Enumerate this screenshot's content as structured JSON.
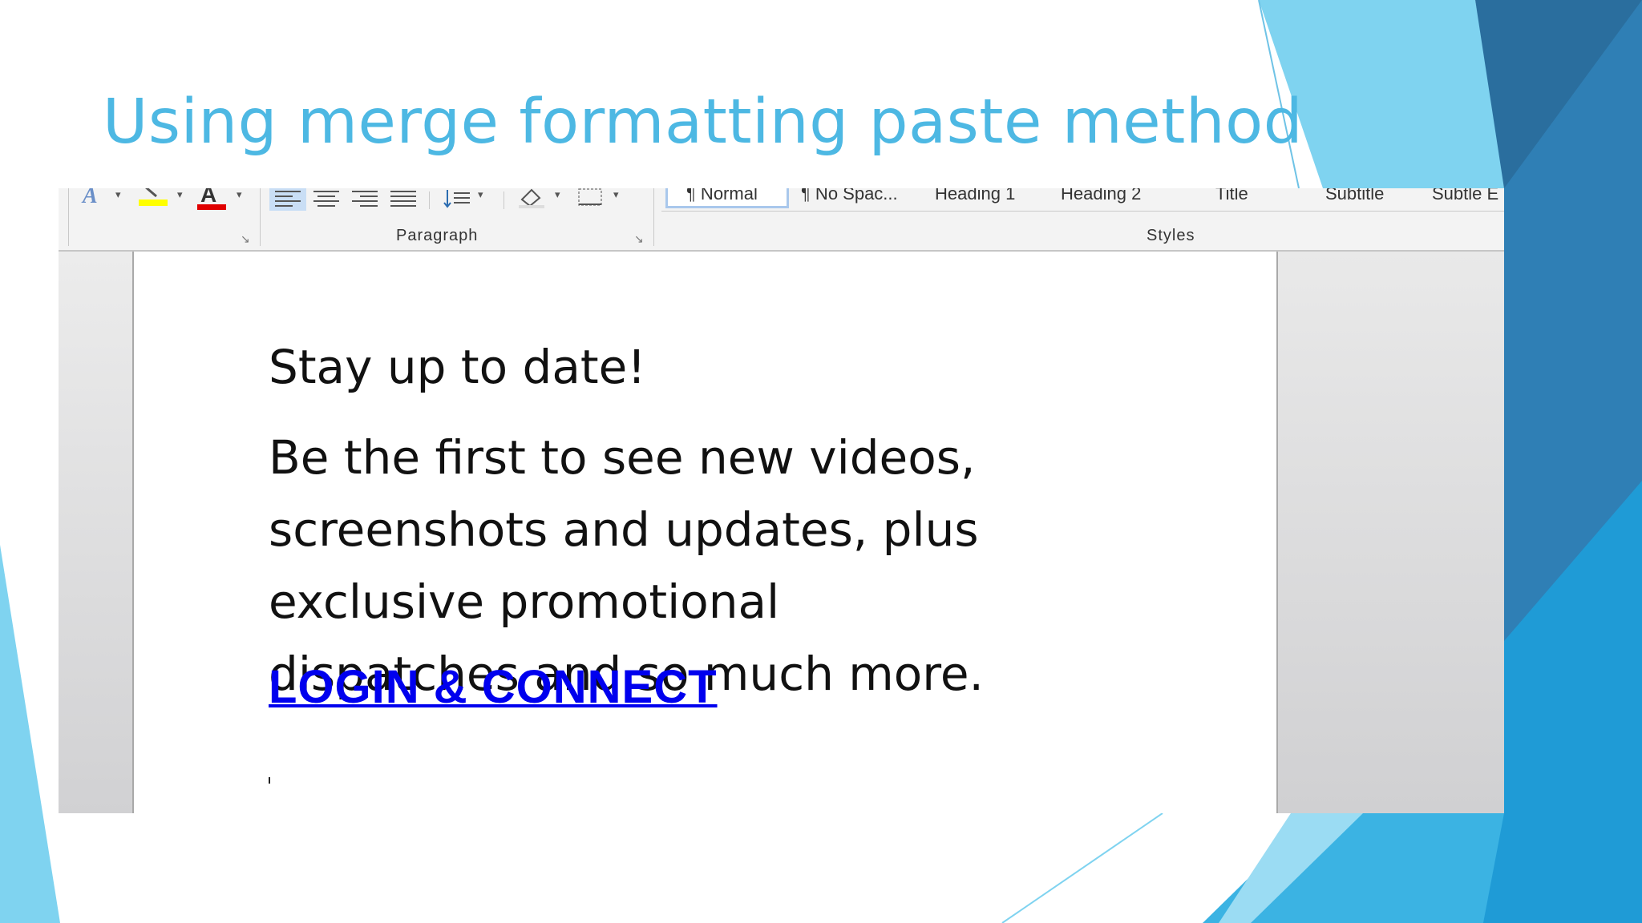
{
  "slide": {
    "title": "Using merge formatting paste method"
  },
  "ribbon": {
    "paragraph_label": "Paragraph",
    "styles_label": "Styles",
    "styles": [
      "¶ Normal",
      "¶ No Spac...",
      "Heading 1",
      "Heading 2",
      "Title",
      "Subtitle",
      "Subtle E"
    ],
    "font_color_glyph": "A",
    "text_effects_glyph": "A",
    "launcher_glyph": "↘",
    "caret_glyph": "▾"
  },
  "document": {
    "heading": "Stay up to date!",
    "body_lines": [
      "Be the first to see new videos,",
      "screenshots and updates, plus",
      "exclusive promotional",
      "dispatches and so much more."
    ],
    "link": "LOGIN & CONNECT"
  },
  "colors": {
    "title": "#4db8e3",
    "link": "#0000ee",
    "highlight": "#ffff00",
    "font_color": "#e00000",
    "accent_light": "#7fd3f0",
    "accent_dark": "#2a6e9e"
  }
}
